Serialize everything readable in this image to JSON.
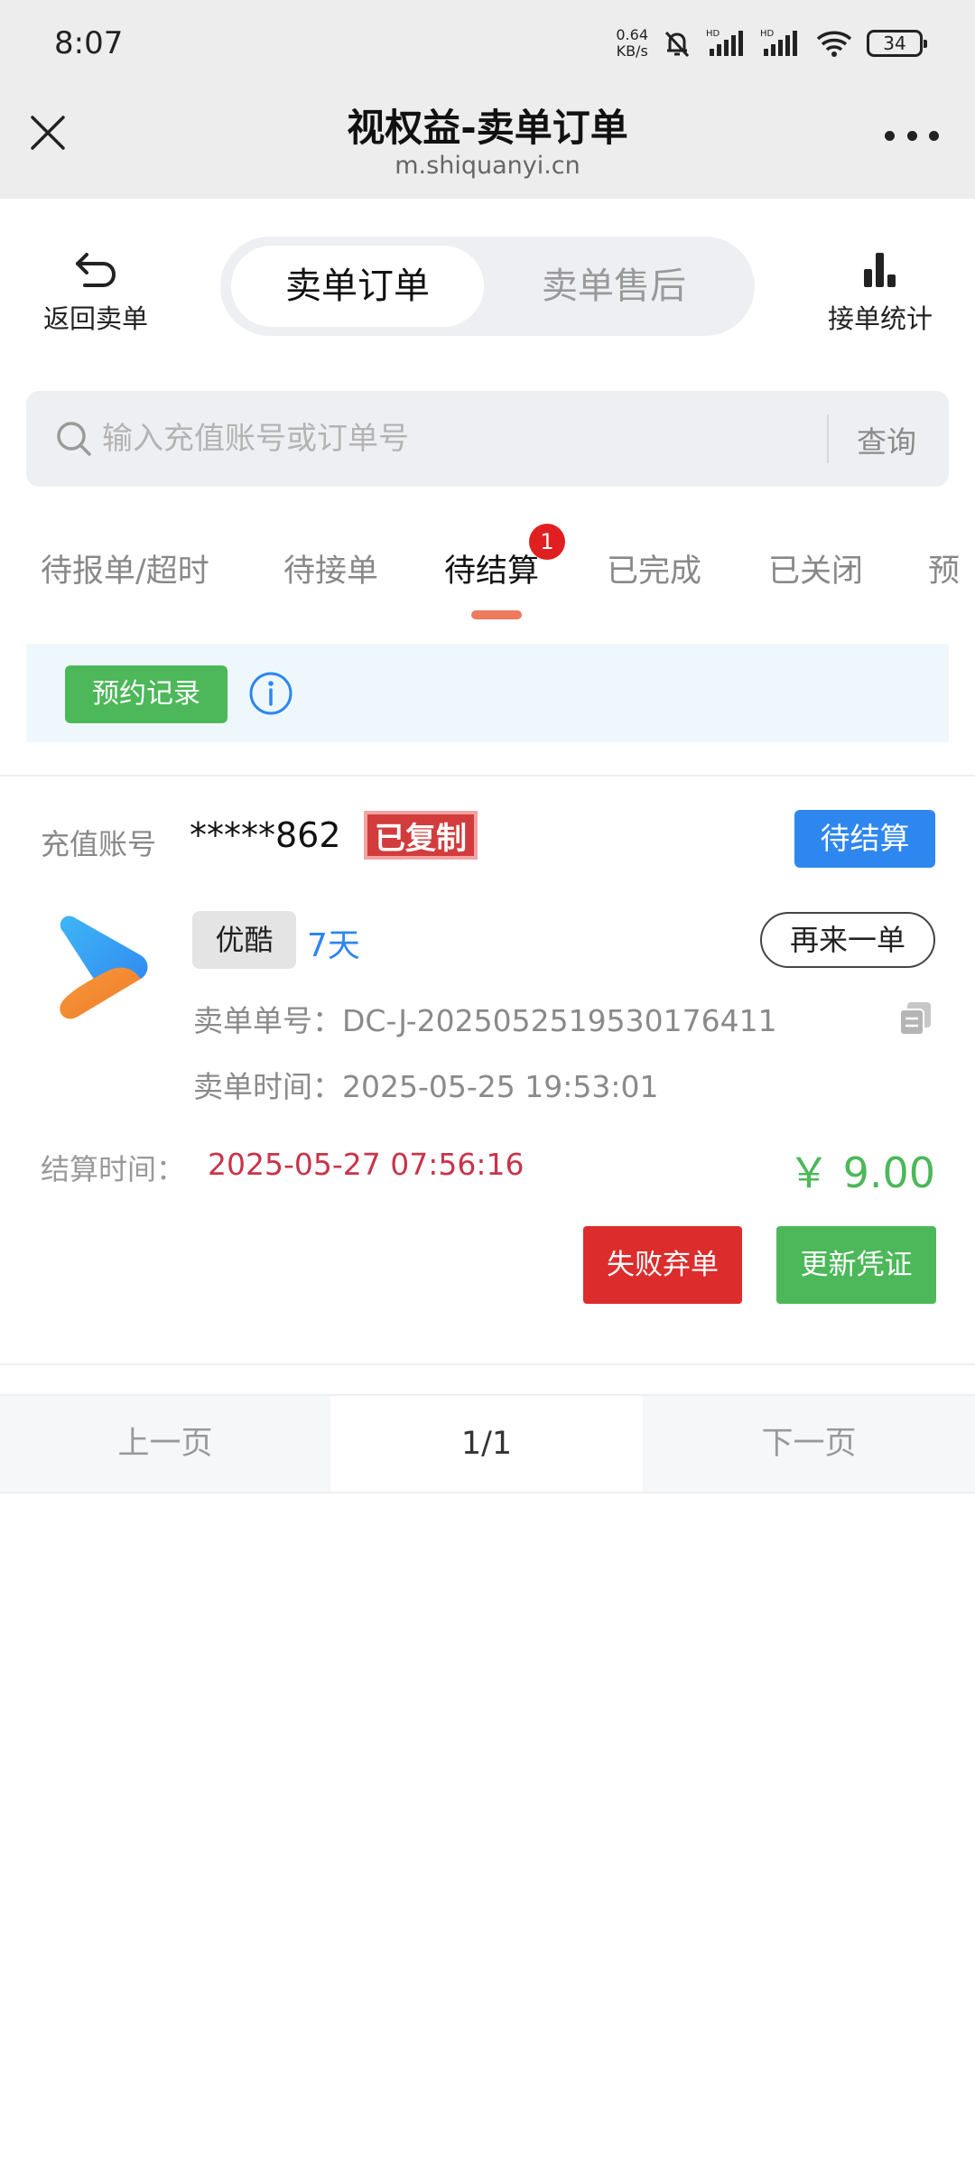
{
  "status_bar": {
    "time": "8:07",
    "net_speed_value": "0.64",
    "net_speed_unit": "KB/s",
    "battery": "34"
  },
  "title_bar": {
    "title": "视权益-卖单订单",
    "subtitle": "m.shiquanyi.cn"
  },
  "nav": {
    "back_label": "返回卖单",
    "segments": [
      {
        "label": "卖单订单",
        "active": true
      },
      {
        "label": "卖单售后",
        "active": false
      }
    ],
    "stats_label": "接单统计"
  },
  "search": {
    "placeholder": "输入充值账号或订单号",
    "button": "查询"
  },
  "tabs": [
    {
      "label": "待报单/超时"
    },
    {
      "label": "待接单"
    },
    {
      "label": "待结算",
      "active": true,
      "badge": "1"
    },
    {
      "label": "已完成"
    },
    {
      "label": "已关闭"
    },
    {
      "label": "预"
    }
  ],
  "notice": {
    "button": "预约记录",
    "info_icon": "info-icon"
  },
  "order": {
    "account_label": "充值账号",
    "account_value": "*****862",
    "copied_label": "已复制",
    "status": "待结算",
    "service_name": "优酷",
    "duration": "7天",
    "again_button": "再来一单",
    "order_no_label": "卖单单号：",
    "order_no": "DC-J-202505251953017641​1",
    "order_time_label": "卖单时间：",
    "order_time": "2025-05-25 19:53:01",
    "settle_label": "结算时间：",
    "settle_time": "2025-05-27 07:56:16",
    "price": "￥ 9.00",
    "fail_button": "失败弃单",
    "update_button": "更新凭证"
  },
  "pager": {
    "prev": "上一页",
    "page": "1/1",
    "next": "下一页"
  },
  "colors": {
    "accent_blue": "#2e86ef",
    "green": "#4cb859",
    "red": "#dc2c2c",
    "tab_underline": "#ee7a5d"
  }
}
